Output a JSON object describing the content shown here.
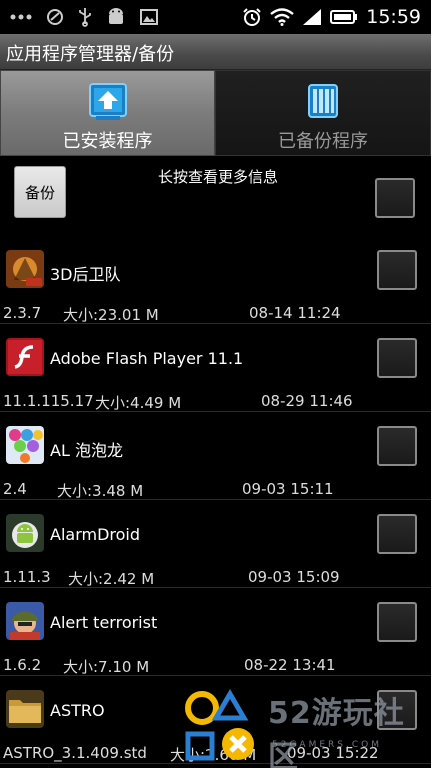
{
  "status_bar": {
    "time": "15:59",
    "left_icons": [
      "more-icon",
      "phone-blocked-icon",
      "usb-icon",
      "android-debug-icon",
      "image-icon"
    ],
    "right_icons": [
      "alarm-icon",
      "wifi-icon",
      "signal-icon",
      "battery-icon"
    ]
  },
  "title": "应用程序管理器/备份",
  "tabs": [
    {
      "label": "已安装程序",
      "active": true,
      "icon": "install-upload-icon"
    },
    {
      "label": "已备份程序",
      "active": false,
      "icon": "backup-server-icon"
    }
  ],
  "header": {
    "backup_button": "备份",
    "hint": "长按查看更多信息"
  },
  "apps": [
    {
      "name": "3D后卫队",
      "version": "2.3.7",
      "size": "大小:23.01 M",
      "date": "08-14 11:24",
      "icon": "game-3d-icon"
    },
    {
      "name": "Adobe Flash Player 11.1",
      "version": "11.1.115.17",
      "size": "大小:4.49 M",
      "date": "08-29 11:46",
      "icon": "flash-icon"
    },
    {
      "name": "AL 泡泡龙",
      "version": "2.4",
      "size": "大小:3.48 M",
      "date": "09-03 15:11",
      "icon": "bubble-game-icon"
    },
    {
      "name": "AlarmDroid",
      "version": "1.11.3",
      "size": "大小:2.42 M",
      "date": "09-03 15:09",
      "icon": "android-alarm-icon"
    },
    {
      "name": "Alert terrorist",
      "version": "1.6.2",
      "size": "大小:7.10 M",
      "date": "08-22 13:41",
      "icon": "soldier-game-icon"
    },
    {
      "name": "ASTRO",
      "version": "ASTRO_3.1.409.std",
      "size": "大小:2.60 M",
      "date": "09-03 15:22",
      "icon": "folder-icon"
    }
  ],
  "watermark": {
    "text": "52游玩社区",
    "sub": "52GAMERS.COM"
  },
  "colors": {
    "background": "#000000",
    "title_bar": "#555555",
    "active_tab": "#8a8a8a",
    "icon_blue": "#2a9fe0"
  }
}
